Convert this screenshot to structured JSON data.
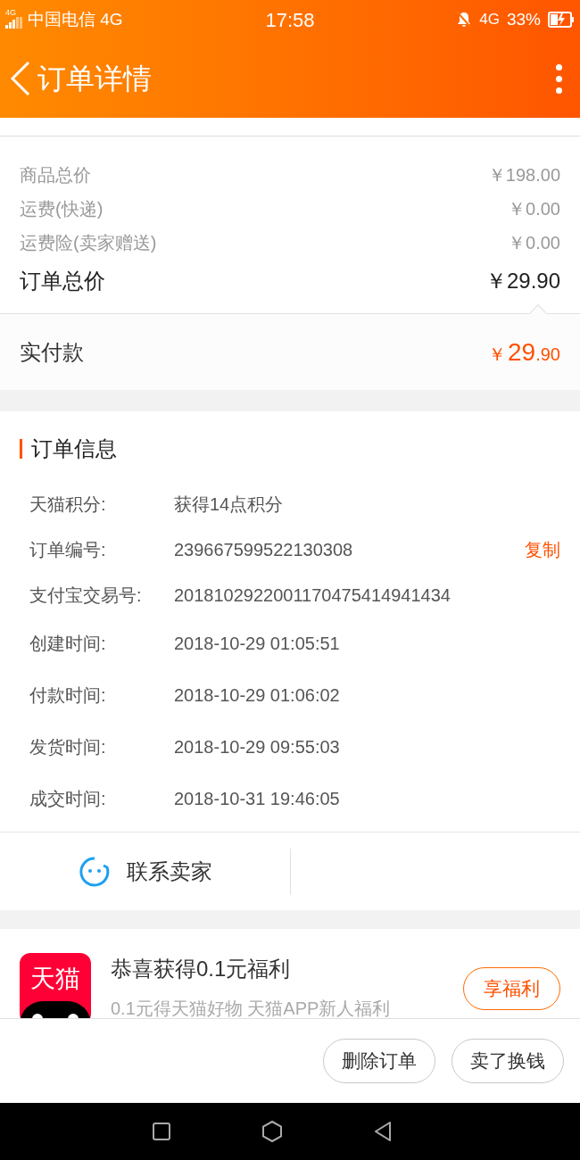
{
  "status_bar": {
    "carrier": "中国电信 4G",
    "signal_label": "4G",
    "time": "17:58",
    "network": "4G",
    "battery": "33%"
  },
  "header": {
    "title": "订单详情"
  },
  "prices": [
    {
      "label": "商品总价",
      "value": "￥198.00",
      "kind": "minor"
    },
    {
      "label": "运费(快递)",
      "value": "￥0.00",
      "kind": "minor"
    },
    {
      "label": "运费险(卖家赠送)",
      "value": "￥0.00",
      "kind": "minor"
    },
    {
      "label": "订单总价",
      "value": "￥29.90",
      "kind": "total"
    }
  ],
  "paid": {
    "label": "实付款",
    "currency": "￥",
    "integer": "29",
    "decimal": ".90"
  },
  "order_info": {
    "title": "订单信息",
    "rows": [
      {
        "label": "天猫积分:",
        "value": "获得14点积分"
      },
      {
        "label": "订单编号:",
        "value": "239667599522130308",
        "action": "复制"
      },
      {
        "label": "支付宝交易号:",
        "value": "2018102922001170475414941434"
      },
      {
        "label": "创建时间:",
        "value": "2018-10-29 01:05:51"
      },
      {
        "label": "付款时间:",
        "value": "2018-10-29 01:06:02"
      },
      {
        "label": "发货时间:",
        "value": "2018-10-29 09:55:03"
      },
      {
        "label": "成交时间:",
        "value": "2018-10-31 19:46:05"
      }
    ]
  },
  "contact": {
    "label": "联系卖家"
  },
  "promo": {
    "logo_text": "天猫",
    "title": "恭喜获得0.1元福利",
    "subtitle": "0.1元得天猫好物 天猫APP新人福利",
    "button": "享福利"
  },
  "actions": [
    "删除订单",
    "卖了换钱"
  ]
}
